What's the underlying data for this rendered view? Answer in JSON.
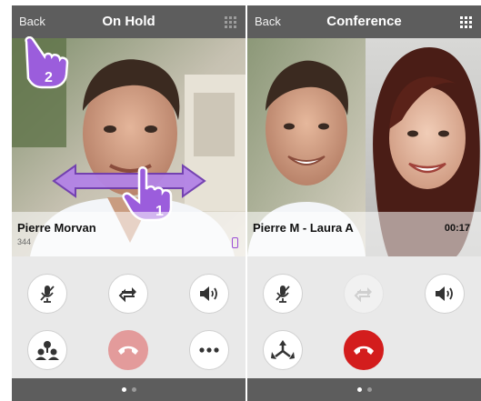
{
  "left_screen": {
    "back_label": "Back",
    "title": "On Hold",
    "contact_name": "Pierre Morvan",
    "contact_number": "344",
    "gesture_step_swipe": "1",
    "gesture_step_back": "2",
    "controls": [
      {
        "name": "mute-button",
        "icon": "microphone-muted-icon",
        "state": "normal"
      },
      {
        "name": "swap-button",
        "icon": "swap-arrows-icon",
        "state": "normal"
      },
      {
        "name": "speaker-button",
        "icon": "speaker-icon",
        "state": "normal"
      },
      {
        "name": "conference-button",
        "icon": "conference-people-icon",
        "state": "normal"
      },
      {
        "name": "hangup-button",
        "icon": "hangup-phone-icon",
        "state": "faded"
      },
      {
        "name": "more-button",
        "icon": "more-dots-icon",
        "state": "normal"
      }
    ],
    "pages": {
      "count": 2,
      "active": 1
    }
  },
  "right_screen": {
    "back_label": "Back",
    "title": "Conference",
    "participants_label": "Pierre M - Laura A",
    "call_duration": "00:17",
    "controls": [
      {
        "name": "mute-button",
        "icon": "microphone-muted-icon",
        "state": "normal"
      },
      {
        "name": "swap-button",
        "icon": "swap-arrows-icon",
        "state": "disabled"
      },
      {
        "name": "speaker-button",
        "icon": "speaker-icon",
        "state": "normal"
      },
      {
        "name": "split-button",
        "icon": "split-call-icon",
        "state": "normal"
      },
      {
        "name": "hangup-button",
        "icon": "hangup-phone-icon",
        "state": "active"
      }
    ],
    "pages": {
      "count": 2,
      "active": 1
    }
  },
  "colors": {
    "header_bg": "#5d5d5d",
    "controls_bg": "#e9e9e9",
    "hangup_red": "#d31d1d",
    "hangup_faded": "#e39b9b",
    "gesture_purple": "#8a4fd0"
  }
}
